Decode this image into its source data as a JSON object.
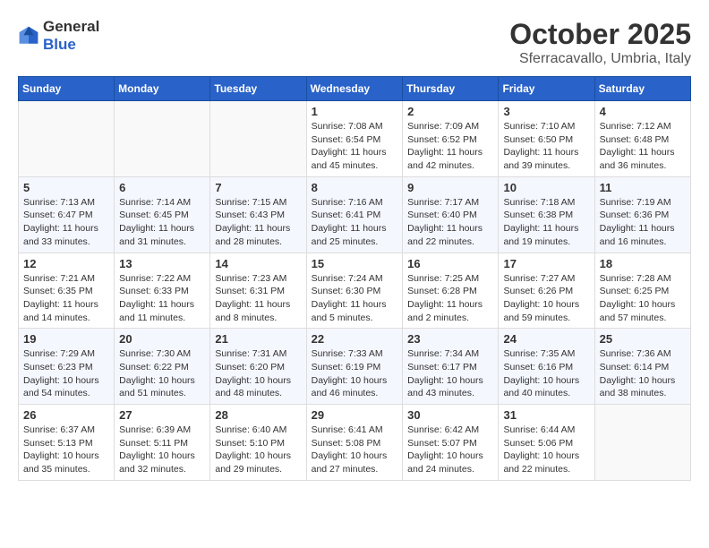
{
  "header": {
    "logo_general": "General",
    "logo_blue": "Blue",
    "month_title": "October 2025",
    "subtitle": "Sferracavallo, Umbria, Italy"
  },
  "days_of_week": [
    "Sunday",
    "Monday",
    "Tuesday",
    "Wednesday",
    "Thursday",
    "Friday",
    "Saturday"
  ],
  "weeks": [
    [
      {
        "day": "",
        "info": ""
      },
      {
        "day": "",
        "info": ""
      },
      {
        "day": "",
        "info": ""
      },
      {
        "day": "1",
        "info": "Sunrise: 7:08 AM\nSunset: 6:54 PM\nDaylight: 11 hours and 45 minutes."
      },
      {
        "day": "2",
        "info": "Sunrise: 7:09 AM\nSunset: 6:52 PM\nDaylight: 11 hours and 42 minutes."
      },
      {
        "day": "3",
        "info": "Sunrise: 7:10 AM\nSunset: 6:50 PM\nDaylight: 11 hours and 39 minutes."
      },
      {
        "day": "4",
        "info": "Sunrise: 7:12 AM\nSunset: 6:48 PM\nDaylight: 11 hours and 36 minutes."
      }
    ],
    [
      {
        "day": "5",
        "info": "Sunrise: 7:13 AM\nSunset: 6:47 PM\nDaylight: 11 hours and 33 minutes."
      },
      {
        "day": "6",
        "info": "Sunrise: 7:14 AM\nSunset: 6:45 PM\nDaylight: 11 hours and 31 minutes."
      },
      {
        "day": "7",
        "info": "Sunrise: 7:15 AM\nSunset: 6:43 PM\nDaylight: 11 hours and 28 minutes."
      },
      {
        "day": "8",
        "info": "Sunrise: 7:16 AM\nSunset: 6:41 PM\nDaylight: 11 hours and 25 minutes."
      },
      {
        "day": "9",
        "info": "Sunrise: 7:17 AM\nSunset: 6:40 PM\nDaylight: 11 hours and 22 minutes."
      },
      {
        "day": "10",
        "info": "Sunrise: 7:18 AM\nSunset: 6:38 PM\nDaylight: 11 hours and 19 minutes."
      },
      {
        "day": "11",
        "info": "Sunrise: 7:19 AM\nSunset: 6:36 PM\nDaylight: 11 hours and 16 minutes."
      }
    ],
    [
      {
        "day": "12",
        "info": "Sunrise: 7:21 AM\nSunset: 6:35 PM\nDaylight: 11 hours and 14 minutes."
      },
      {
        "day": "13",
        "info": "Sunrise: 7:22 AM\nSunset: 6:33 PM\nDaylight: 11 hours and 11 minutes."
      },
      {
        "day": "14",
        "info": "Sunrise: 7:23 AM\nSunset: 6:31 PM\nDaylight: 11 hours and 8 minutes."
      },
      {
        "day": "15",
        "info": "Sunrise: 7:24 AM\nSunset: 6:30 PM\nDaylight: 11 hours and 5 minutes."
      },
      {
        "day": "16",
        "info": "Sunrise: 7:25 AM\nSunset: 6:28 PM\nDaylight: 11 hours and 2 minutes."
      },
      {
        "day": "17",
        "info": "Sunrise: 7:27 AM\nSunset: 6:26 PM\nDaylight: 10 hours and 59 minutes."
      },
      {
        "day": "18",
        "info": "Sunrise: 7:28 AM\nSunset: 6:25 PM\nDaylight: 10 hours and 57 minutes."
      }
    ],
    [
      {
        "day": "19",
        "info": "Sunrise: 7:29 AM\nSunset: 6:23 PM\nDaylight: 10 hours and 54 minutes."
      },
      {
        "day": "20",
        "info": "Sunrise: 7:30 AM\nSunset: 6:22 PM\nDaylight: 10 hours and 51 minutes."
      },
      {
        "day": "21",
        "info": "Sunrise: 7:31 AM\nSunset: 6:20 PM\nDaylight: 10 hours and 48 minutes."
      },
      {
        "day": "22",
        "info": "Sunrise: 7:33 AM\nSunset: 6:19 PM\nDaylight: 10 hours and 46 minutes."
      },
      {
        "day": "23",
        "info": "Sunrise: 7:34 AM\nSunset: 6:17 PM\nDaylight: 10 hours and 43 minutes."
      },
      {
        "day": "24",
        "info": "Sunrise: 7:35 AM\nSunset: 6:16 PM\nDaylight: 10 hours and 40 minutes."
      },
      {
        "day": "25",
        "info": "Sunrise: 7:36 AM\nSunset: 6:14 PM\nDaylight: 10 hours and 38 minutes."
      }
    ],
    [
      {
        "day": "26",
        "info": "Sunrise: 6:37 AM\nSunset: 5:13 PM\nDaylight: 10 hours and 35 minutes."
      },
      {
        "day": "27",
        "info": "Sunrise: 6:39 AM\nSunset: 5:11 PM\nDaylight: 10 hours and 32 minutes."
      },
      {
        "day": "28",
        "info": "Sunrise: 6:40 AM\nSunset: 5:10 PM\nDaylight: 10 hours and 29 minutes."
      },
      {
        "day": "29",
        "info": "Sunrise: 6:41 AM\nSunset: 5:08 PM\nDaylight: 10 hours and 27 minutes."
      },
      {
        "day": "30",
        "info": "Sunrise: 6:42 AM\nSunset: 5:07 PM\nDaylight: 10 hours and 24 minutes."
      },
      {
        "day": "31",
        "info": "Sunrise: 6:44 AM\nSunset: 5:06 PM\nDaylight: 10 hours and 22 minutes."
      },
      {
        "day": "",
        "info": ""
      }
    ]
  ]
}
